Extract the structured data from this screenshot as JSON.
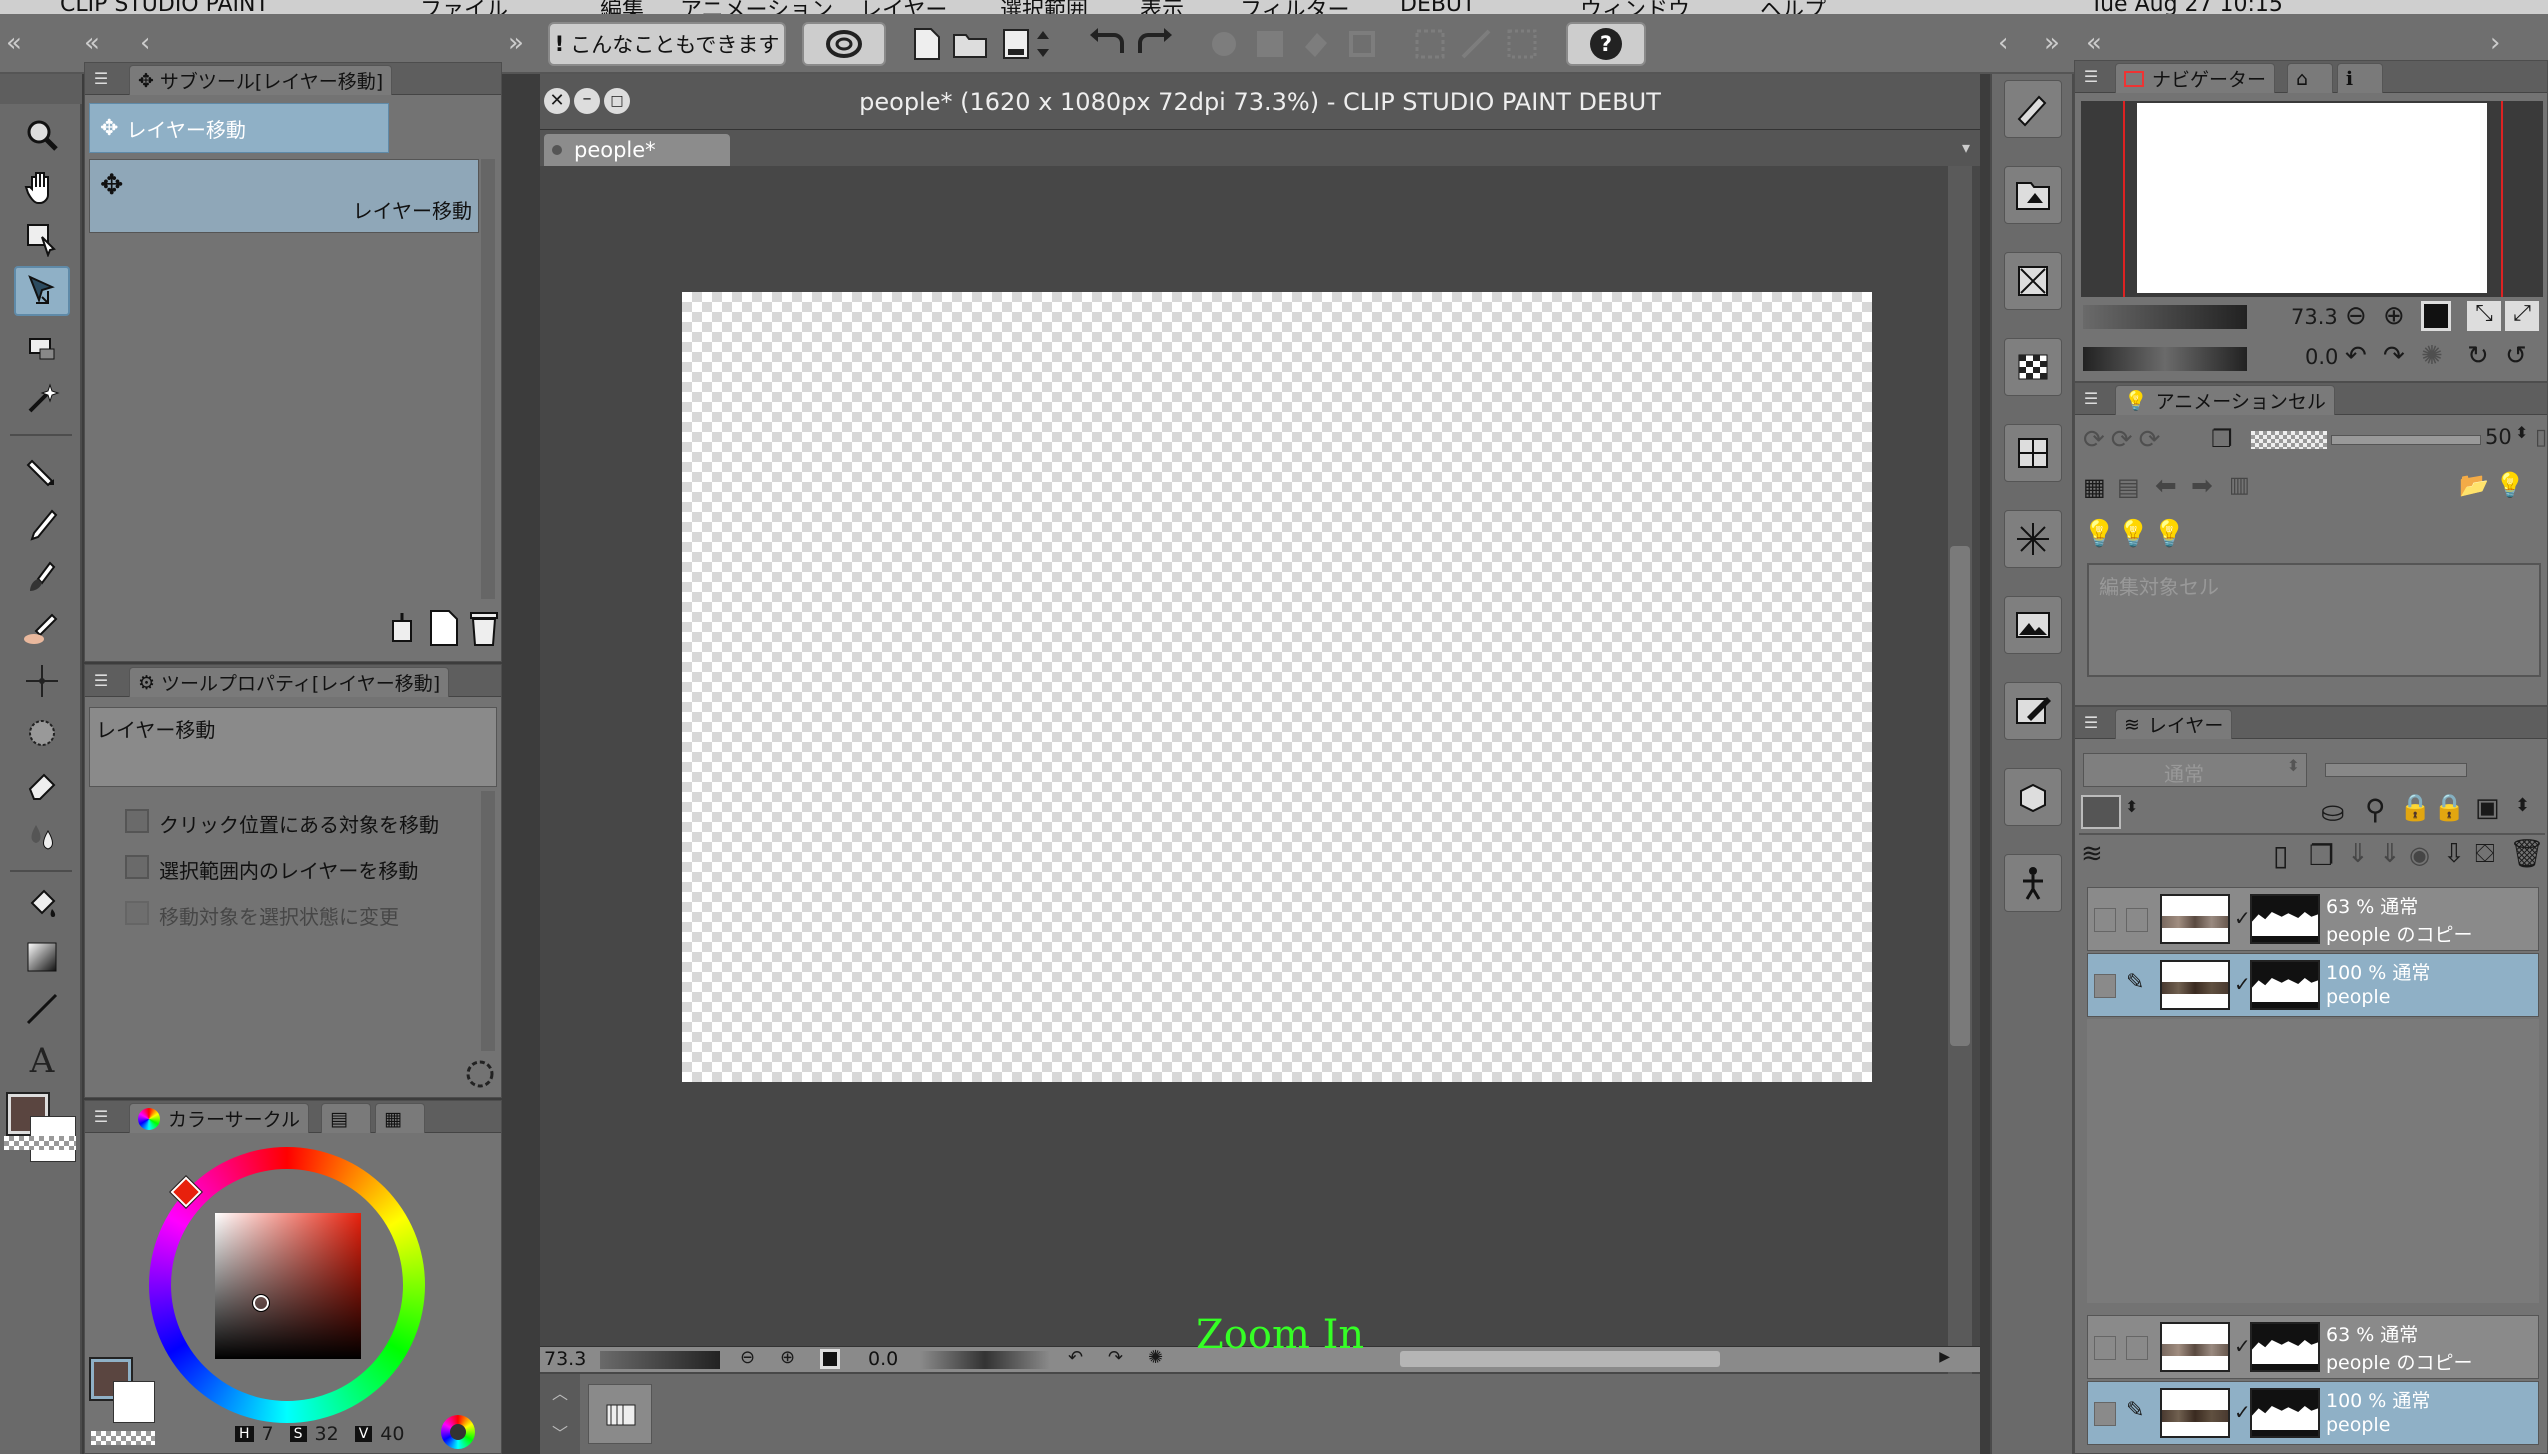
{
  "menubar": {
    "items": [
      "CLIP STUDIO PAINT",
      "ファイル",
      "編集",
      "アニメーション",
      "レイヤー",
      "選択範囲",
      "表示",
      "フィルター",
      "DEBUT",
      "ウィンドウ",
      "ヘルプ",
      "Tue Aug 27 10:15"
    ]
  },
  "commandbar": {
    "tip_button": "こんなこともできます",
    "help_label": "?"
  },
  "subtool": {
    "tab": "サブツール[レイヤー移動]",
    "group": "レイヤー移動",
    "item": "レイヤー移動"
  },
  "toolprop": {
    "tab": "ツールプロパティ[レイヤー移動]",
    "title": "レイヤー移動",
    "options": [
      {
        "label": "クリック位置にある対象を移動",
        "enabled": true
      },
      {
        "label": "選択範囲内のレイヤーを移動",
        "enabled": true
      },
      {
        "label": "移動対象を選択状態に変更",
        "enabled": false
      }
    ]
  },
  "colorpanel": {
    "tab": "カラーサークル",
    "h_label": "H",
    "h_value": "7",
    "s_label": "S",
    "s_value": "32",
    "v_label": "V",
    "v_value": "40",
    "main_color": "#5a4540",
    "sub_color": "#ffffff"
  },
  "canvas": {
    "title": "people* (1620 x 1080px 72dpi 73.3%)  - CLIP STUDIO PAINT DEBUT",
    "tab": "people*",
    "zoom": "73.3",
    "rotation": "0.0"
  },
  "navigator": {
    "tab": "ナビゲーター",
    "zoom": "73.3",
    "rotation": "0.0"
  },
  "animation": {
    "tab": "アニメーションセル",
    "opacity": "50",
    "placeholder": "編集対象セル"
  },
  "layers": {
    "tab": "レイヤー",
    "blend": "通常",
    "rows": [
      {
        "mode": "63 % 通常",
        "name": "people のコピー",
        "selected": false
      },
      {
        "mode": "100 % 通常",
        "name": "people",
        "selected": true
      }
    ],
    "rows_bottom": [
      {
        "mode": "63 % 通常",
        "name": "people のコピー",
        "selected": false
      },
      {
        "mode": "100 % 通常",
        "name": "people",
        "selected": true
      }
    ]
  },
  "overlay": {
    "zoom_in": "Zoom In"
  }
}
